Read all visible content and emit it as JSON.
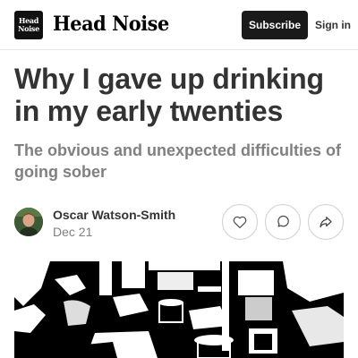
{
  "header": {
    "logo_badge_text": "Head Noise",
    "logo_text": "Head Noise",
    "subscribe_label": "Subscribe",
    "signin_label": "Sign in"
  },
  "post": {
    "title": "Why I gave up drinking in my early twenties",
    "subtitle": "The obvious and unexpected difficulties of going sober",
    "author": "Oscar Watson-Smith",
    "date": "Dec 21"
  },
  "actions": {
    "like_icon": "heart-icon",
    "comment_icon": "comment-icon",
    "share_icon": "share-icon"
  },
  "colors": {
    "subscribe_bg": "#1a1a1a",
    "title": "#333333",
    "subtitle": "#808080"
  }
}
